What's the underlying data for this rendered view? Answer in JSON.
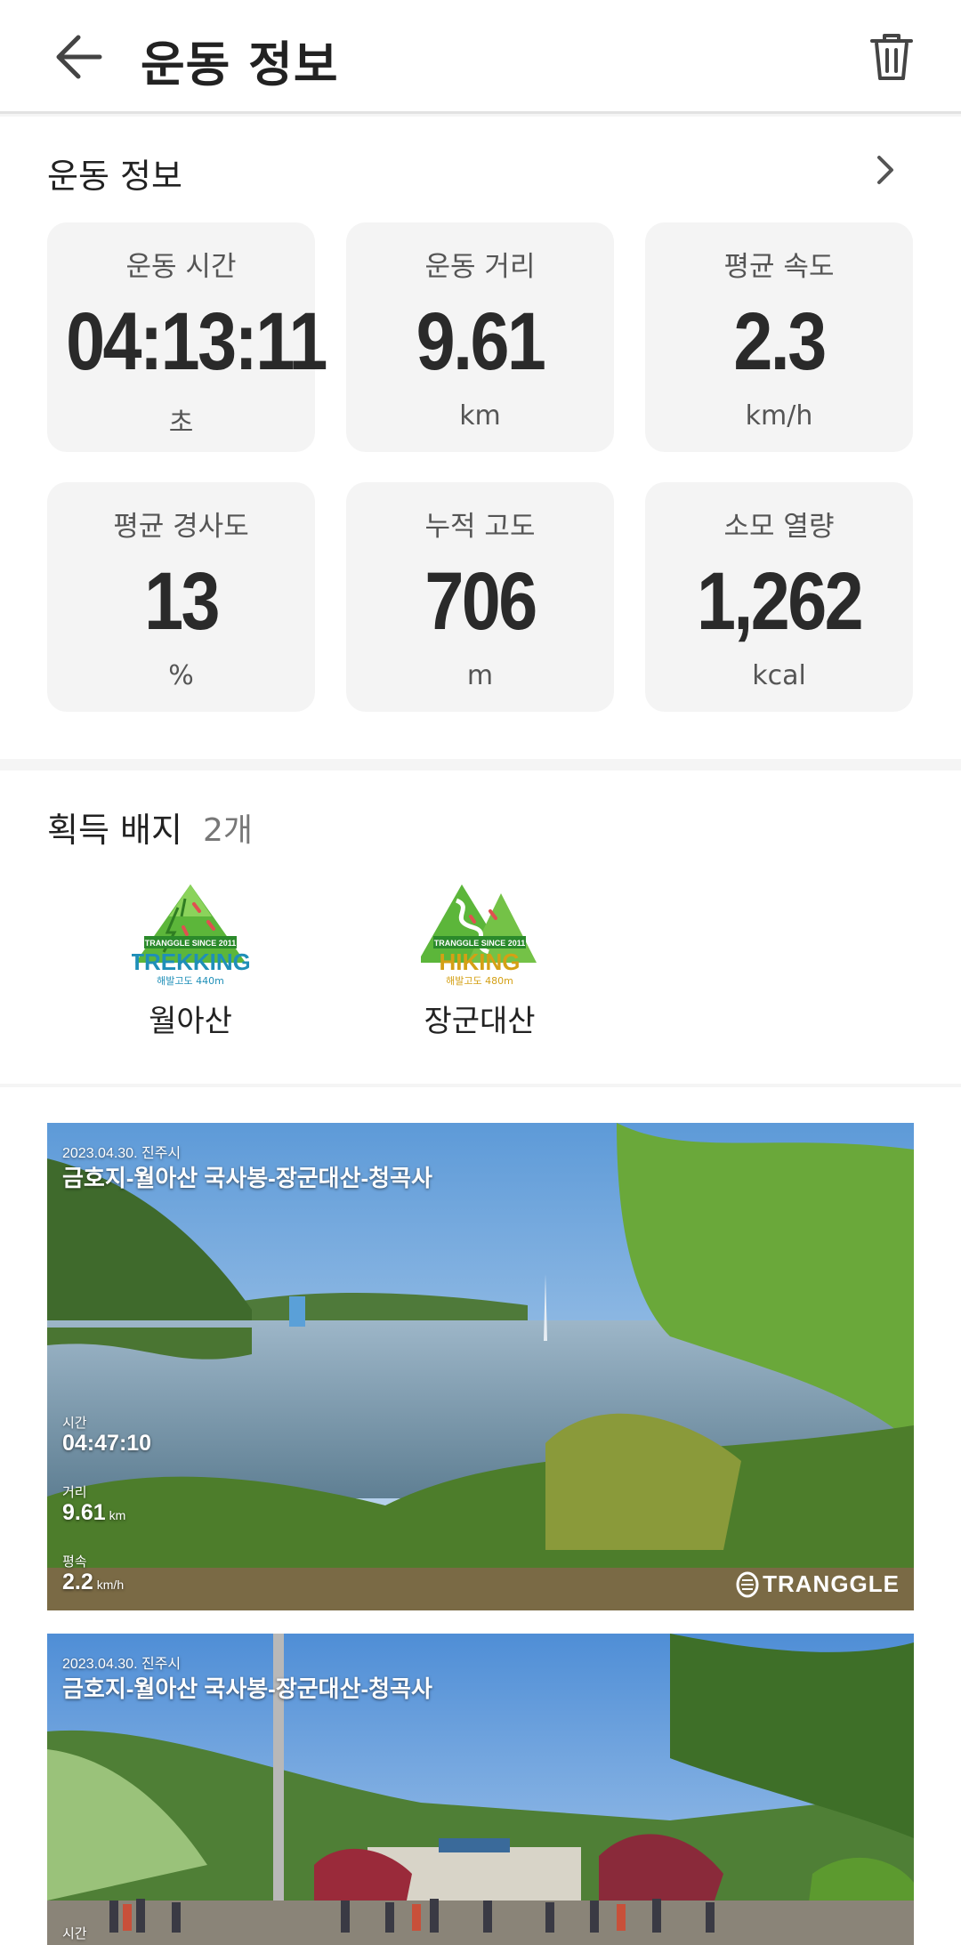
{
  "header": {
    "title": "운동 정보"
  },
  "stats": {
    "section_title": "운동 정보",
    "items": [
      {
        "label": "운동 시간",
        "value": "04:13:11",
        "unit": "초"
      },
      {
        "label": "운동 거리",
        "value": "9.61",
        "unit": "km"
      },
      {
        "label": "평균 속도",
        "value": "2.3",
        "unit": "km/h"
      },
      {
        "label": "평균 경사도",
        "value": "13",
        "unit": "%"
      },
      {
        "label": "누적 고도",
        "value": "706",
        "unit": "m"
      },
      {
        "label": "소모 열량",
        "value": "1,262",
        "unit": "kcal"
      }
    ]
  },
  "badges": {
    "title": "획득 배지",
    "count": "2개",
    "items": [
      {
        "name": "월아산",
        "banner": "TRANGGLE SINCE 2011",
        "type": "TREKKING",
        "alt": "해발고도 440m",
        "color": "#1f8fb8"
      },
      {
        "name": "장군대산",
        "banner": "TRANGGLE SINCE 2011",
        "type": "HIKING",
        "alt": "해발고도 480m",
        "color": "#d4a015"
      }
    ]
  },
  "photos": [
    {
      "date": "2023.04.30. 진주시",
      "route": "금호지-월아산 국사봉-장군대산-청곡사",
      "time_label": "시간",
      "time": "04:47:10",
      "dist_label": "거리",
      "dist": "9.61",
      "dist_unit": "km",
      "speed_label": "평속",
      "speed": "2.2",
      "speed_unit": "km/h",
      "logo": "TRANGGLE"
    },
    {
      "date": "2023.04.30. 진주시",
      "route": "금호지-월아산 국사봉-장군대산-청곡사",
      "time_label": "시간"
    }
  ]
}
